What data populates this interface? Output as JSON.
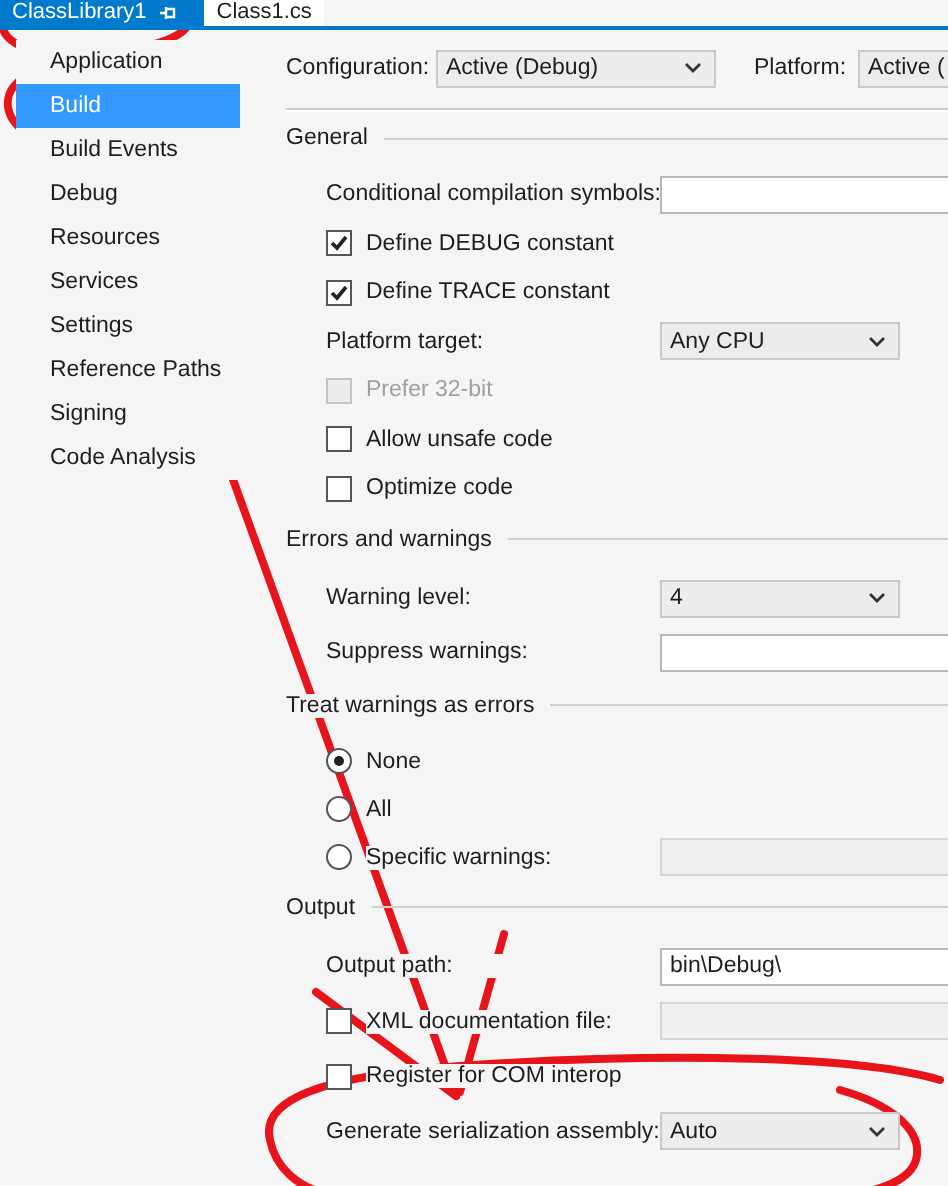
{
  "tabs": [
    {
      "label": "ClassLibrary1",
      "selected": true
    },
    {
      "label": "Class1.cs",
      "selected": false
    }
  ],
  "sidebar": {
    "items": [
      {
        "label": "Application",
        "selected": false
      },
      {
        "label": "Build",
        "selected": true
      },
      {
        "label": "Build Events",
        "selected": false
      },
      {
        "label": "Debug",
        "selected": false
      },
      {
        "label": "Resources",
        "selected": false
      },
      {
        "label": "Services",
        "selected": false
      },
      {
        "label": "Settings",
        "selected": false
      },
      {
        "label": "Reference Paths",
        "selected": false
      },
      {
        "label": "Signing",
        "selected": false
      },
      {
        "label": "Code Analysis",
        "selected": false
      }
    ]
  },
  "configuration": {
    "label": "Configuration:",
    "value": "Active (Debug)"
  },
  "platform": {
    "label": "Platform:",
    "value": "Active ("
  },
  "sections": [
    {
      "title": "General",
      "rows": [
        {
          "kind": "field",
          "label": "Conditional compilation symbols:",
          "disabled": false
        },
        {
          "kind": "checkbox",
          "label": "Define DEBUG constant",
          "checked": true,
          "disabled": false
        },
        {
          "kind": "checkbox",
          "label": "Define TRACE constant",
          "checked": true,
          "disabled": false
        },
        {
          "kind": "select",
          "label": "Platform target:",
          "value": "Any CPU"
        },
        {
          "kind": "checkbox",
          "label": "Prefer 32-bit",
          "checked": false,
          "disabled": true
        },
        {
          "kind": "checkbox",
          "label": "Allow unsafe code",
          "checked": false,
          "disabled": false
        },
        {
          "kind": "checkbox",
          "label": "Optimize code",
          "checked": false,
          "disabled": false
        }
      ]
    },
    {
      "title": "Errors and warnings",
      "rows": [
        {
          "kind": "select",
          "label": "Warning level:",
          "value": "4"
        },
        {
          "kind": "field",
          "label": "Suppress warnings:",
          "disabled": false
        }
      ]
    },
    {
      "title": "Treat warnings as errors",
      "rows": [
        {
          "kind": "radio",
          "label": "None",
          "selected": true
        },
        {
          "kind": "radio",
          "label": "All",
          "selected": false
        },
        {
          "kind": "radio",
          "label": "Specific warnings:",
          "selected": false,
          "field_disabled": true
        }
      ]
    },
    {
      "title": "Output",
      "rows": [
        {
          "kind": "field",
          "label": "Output path:",
          "value": "bin\\Debug\\",
          "disabled": false
        },
        {
          "kind": "checkbox",
          "label": "XML documentation file:",
          "checked": false,
          "disabled": false,
          "field_disabled": true
        },
        {
          "kind": "checkbox",
          "label": "Register for COM interop",
          "checked": false,
          "disabled": false
        },
        {
          "kind": "select",
          "label": "Generate serialization assembly:",
          "value": "Auto"
        }
      ]
    }
  ]
}
